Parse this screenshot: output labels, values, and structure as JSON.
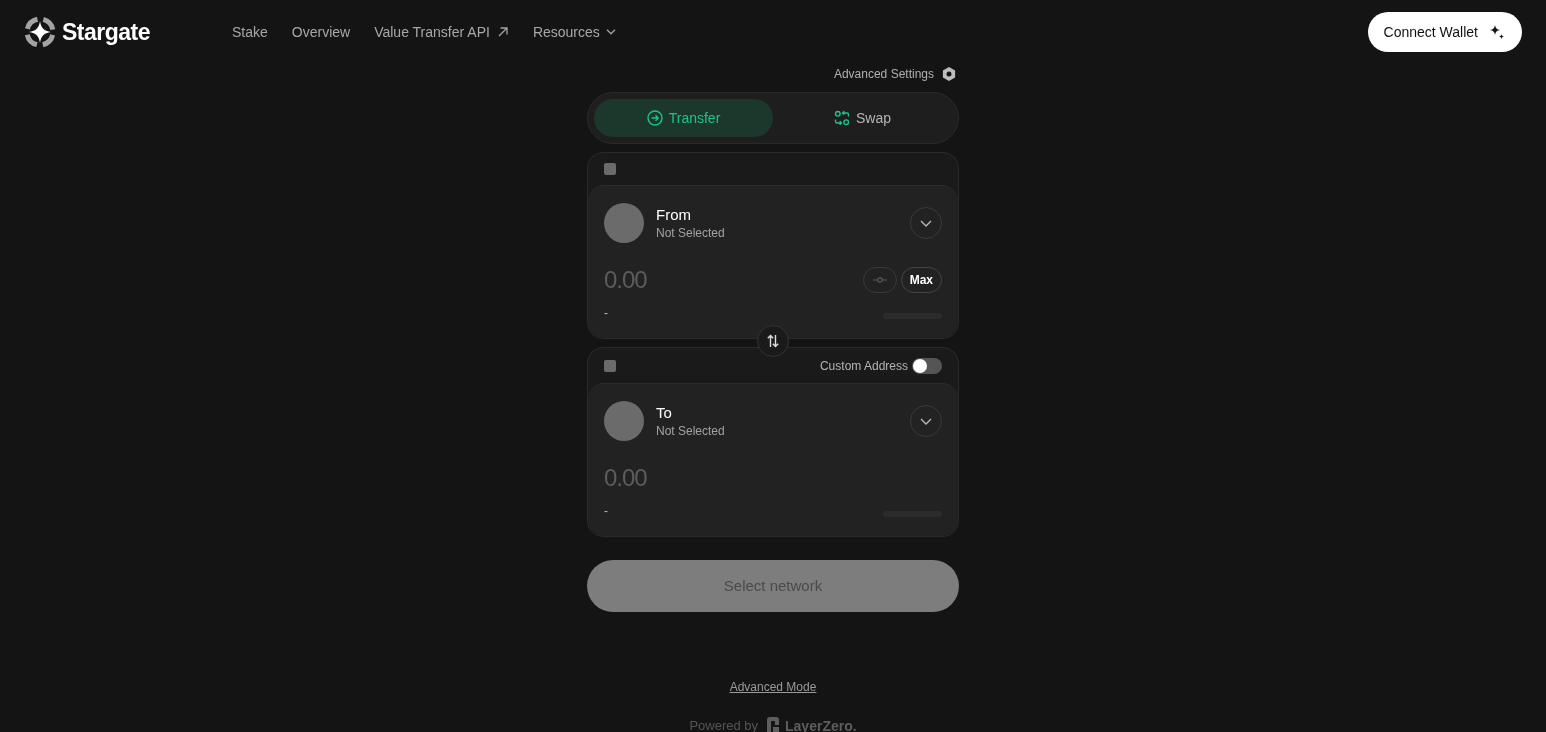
{
  "header": {
    "logo_text": "Stargate",
    "nav": [
      {
        "label": "Stake",
        "kind": "link"
      },
      {
        "label": "Overview",
        "kind": "link"
      },
      {
        "label": "Value Transfer API",
        "kind": "external"
      },
      {
        "label": "Resources",
        "kind": "dropdown"
      }
    ],
    "connect_button": "Connect Wallet"
  },
  "advanced_settings": "Advanced Settings",
  "tabs": [
    {
      "label": "Transfer",
      "kind": "transfer",
      "selected": true
    },
    {
      "label": "Swap",
      "kind": "swap",
      "selected": false
    }
  ],
  "panels": [
    {
      "title": "From",
      "subtitle": "Not Selected",
      "amount": {
        "placeholder": "0.00"
      },
      "max_button": "Max",
      "usd_value": "-"
    },
    {
      "title": "To",
      "subtitle": "Not Selected",
      "custom_address": {
        "label": "Custom Address",
        "on": false
      },
      "amount": {
        "placeholder": "0.00"
      },
      "usd_value": "-"
    }
  ],
  "submit_button": {
    "label": "Select network",
    "disabled": true
  },
  "footer": {
    "advanced_mode_link": "Advanced Mode",
    "powered_by": "Powered by",
    "brand": "LayerZero."
  }
}
